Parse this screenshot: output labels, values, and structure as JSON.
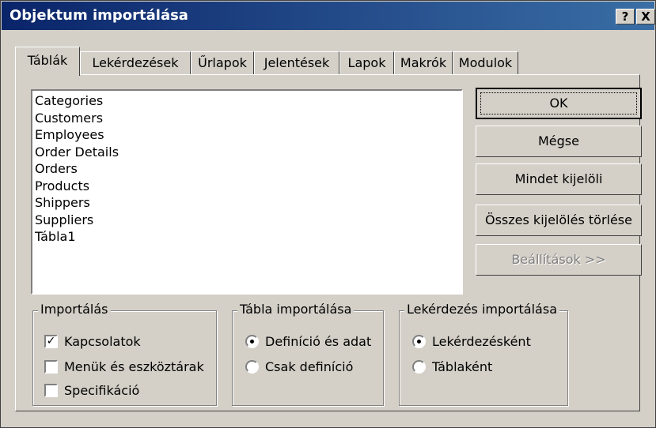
{
  "window": {
    "title": "Objektum importálása",
    "help_btn": "?",
    "close_btn": "X"
  },
  "tabs": [
    "Táblák",
    "Lekérdezések",
    "Űrlapok",
    "Jelentések",
    "Lapok",
    "Makrók",
    "Modulok"
  ],
  "list": [
    "Categories",
    "Customers",
    "Employees",
    "Order Details",
    "Orders",
    "Products",
    "Shippers",
    "Suppliers",
    "Tábla1"
  ],
  "buttons": {
    "ok": "OK",
    "cancel": "Mégse",
    "select_all": "Mindet kijelöli",
    "deselect_all": "Összes kijelölés törlése",
    "options": "Beállítások >>"
  },
  "groups": {
    "import": {
      "title": "Importálás",
      "items": [
        {
          "label": "Kapcsolatok",
          "checked": true
        },
        {
          "label": "Menük és eszköztárak",
          "checked": false
        },
        {
          "label": "Specifikáció",
          "checked": false
        }
      ]
    },
    "table_import": {
      "title": "Tábla importálása",
      "items": [
        {
          "label": "Definíció és adat",
          "selected": true
        },
        {
          "label": "Csak definíció",
          "selected": false
        }
      ]
    },
    "query_import": {
      "title": "Lekérdezés importálása",
      "items": [
        {
          "label": "Lekérdezésként",
          "selected": true
        },
        {
          "label": "Táblaként",
          "selected": false
        }
      ]
    }
  }
}
